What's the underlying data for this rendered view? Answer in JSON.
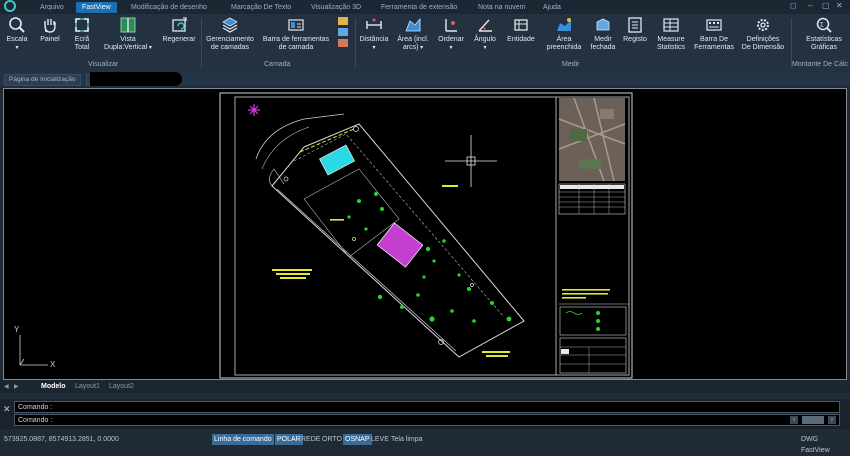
{
  "menu": {
    "tabs": [
      "Arquivo",
      "FastView",
      "Modificação de desenho",
      "Marcação De Texto",
      "Visualização 3D",
      "Ferramenta de extensão",
      "Nota na nuvem",
      "Ajuda"
    ],
    "active_tab": "FastView",
    "app_title": "DWG FastView"
  },
  "ribbon": {
    "buttons": {
      "escala": "Escala",
      "painel": "Painel",
      "ecra_total": [
        "Ecrã",
        "Total"
      ],
      "vista_dupla": [
        "Vista",
        "Dupla:Vertical"
      ],
      "regenerar": "Regenerar",
      "gerenciamento": [
        "Gerenciamento",
        "de camadas"
      ],
      "barra_camada": [
        "Barra de ferramentas",
        "de camada"
      ],
      "distancia": "Distância",
      "area": [
        "Área (incl.",
        "arcs)"
      ],
      "ordenar": "Ordenar",
      "angulo": "Ângulo",
      "entidade": "Entidade",
      "area_preenchida": [
        "Área",
        "preenchida"
      ],
      "medir_fechada": [
        "Medir",
        "fechada"
      ],
      "registo": "Registo",
      "measure_statistics": [
        "Measure",
        "Statistics"
      ],
      "barra_ferramentas": [
        "Barra De",
        "Ferramentas"
      ],
      "definicoes_dimensao": [
        "Definições",
        "De Dimensão"
      ],
      "estatisticas_graficas": [
        "Estatísticas",
        "Gráficas"
      ]
    },
    "groups": {
      "visualizar": "Visualizar",
      "camada": "Camada",
      "medir": "Medir",
      "montante": "Montante De Cálc"
    }
  },
  "document_tab": "Página de Inicialização",
  "drawing": {
    "ucs_x": "X",
    "ucs_y": "Y"
  },
  "layout_tabs": [
    "Modelo",
    "Layout1",
    "Layout2"
  ],
  "command": {
    "line1": "Comando :",
    "line2": "Comando :"
  },
  "status": {
    "coords": "573925.0887, 8574913.2851, 0.0000",
    "toggles": [
      {
        "label": "Linha de comando",
        "on": true
      },
      {
        "label": "POLAR",
        "on": true
      },
      {
        "label": "REDE",
        "on": false
      },
      {
        "label": "ORTO",
        "on": false
      },
      {
        "label": "OSNAP",
        "on": true
      },
      {
        "label": "LEVE",
        "on": false
      },
      {
        "label": "Tela limpa",
        "on": false
      }
    ],
    "app_name": "DWG FastView"
  }
}
